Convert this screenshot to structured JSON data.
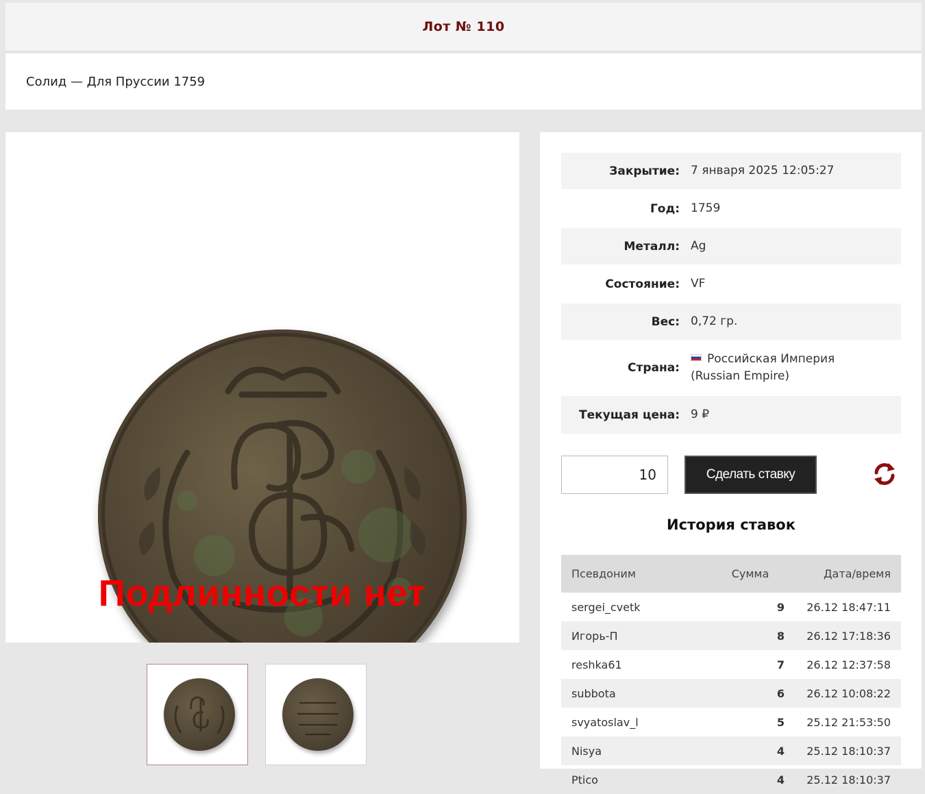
{
  "header": {
    "lot_title": "Лот № 110"
  },
  "lot": {
    "name": "Солид — Для Пруссии 1759"
  },
  "image": {
    "watermark": "Подлинности нет",
    "thumbnails": [
      "obverse",
      "reverse"
    ]
  },
  "details": {
    "closing_label": "Закрытие:",
    "closing_value": "7 января 2025  12:05:27",
    "year_label": "Год:",
    "year_value": "1759",
    "metal_label": "Металл:",
    "metal_value": "Ag",
    "condition_label": "Состояние:",
    "condition_value": "VF",
    "weight_label": "Вес:",
    "weight_value": "0,72 гр.",
    "country_label": "Страна:",
    "country_value_line1": "Российская Империя",
    "country_value_line2": "(Russian Empire)",
    "price_label": "Текущая цена:",
    "price_value": "9 ₽"
  },
  "bid": {
    "input_value": "10",
    "button_label": "Сделать ставку",
    "refresh_icon": "refresh-icon"
  },
  "history": {
    "title": "История ставок",
    "columns": [
      "Псевдоним",
      "Сумма",
      "Дата/время"
    ],
    "rows": [
      {
        "nick": "sergei_cvetk",
        "sum": "9",
        "date": "26.12 18:47:11"
      },
      {
        "nick": "Игорь-П",
        "sum": "8",
        "date": "26.12 17:18:36"
      },
      {
        "nick": "reshka61",
        "sum": "7",
        "date": "26.12 12:37:58"
      },
      {
        "nick": "subbota",
        "sum": "6",
        "date": "26.12 10:08:22"
      },
      {
        "nick": "svyatoslav_l",
        "sum": "5",
        "date": "25.12 21:53:50"
      },
      {
        "nick": "Nisya",
        "sum": "4",
        "date": "25.12 18:10:37"
      },
      {
        "nick": "Ptico",
        "sum": "4",
        "date": "25.12 18:10:37"
      }
    ]
  },
  "colors": {
    "title": "#6b1010",
    "watermark": "#ee0000",
    "button_bg": "#222222",
    "refresh": "#8b0f0f"
  }
}
